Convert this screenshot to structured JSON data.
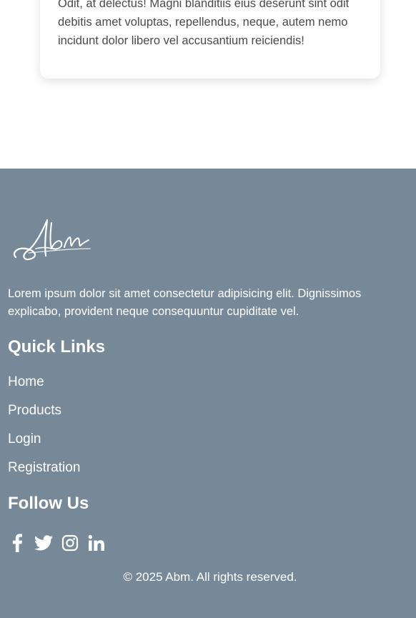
{
  "card": {
    "text": "Odit, at delectus! Magni blanditiis eius deserunt sint odit debitis amet voluptas, repellendus, neque, autem nemo incidunt dolor libero vel accusantium reiciendis!"
  },
  "footer": {
    "logo_text": "Abm",
    "description": "Lorem ipsum dolor sit amet consectetur adipisicing elit. Dignissimos explicabo, provident neque consequuntur cupiditate vel.",
    "quick_links_heading": "Quick Links",
    "links": [
      {
        "label": "Home"
      },
      {
        "label": "Products"
      },
      {
        "label": "Login"
      },
      {
        "label": "Registration"
      }
    ],
    "follow_heading": "Follow Us",
    "social": [
      {
        "icon": "facebook-icon"
      },
      {
        "icon": "twitter-icon"
      },
      {
        "icon": "instagram-icon"
      },
      {
        "icon": "linkedin-icon"
      }
    ],
    "copyright": "© 2025 Abm. All rights reserved."
  },
  "colors": {
    "footer_bg": "#778899",
    "footer_text": "#ffffff",
    "card_text": "#4a4a4a"
  }
}
